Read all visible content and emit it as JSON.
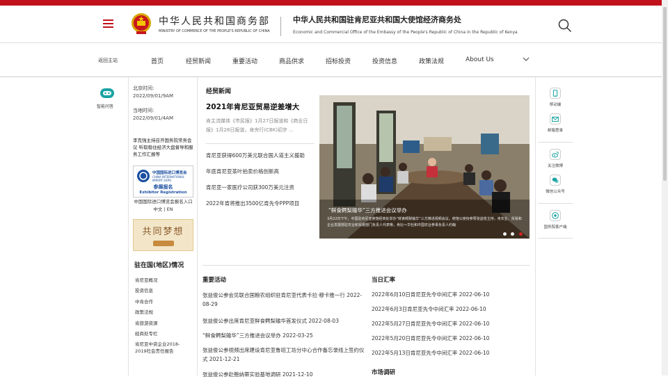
{
  "header": {
    "ministry_cn": "中华人民共和国商务部",
    "ministry_en": "MINISTRY OF COMMERCE OF THE PEOPLE'S REPUBLIC OF CHINA",
    "office_cn": "中华人民共和国驻肯尼亚共和国大使馆经济商务处",
    "office_en": "Economic and Commercial Office of the Embassy of the People's Republic of China in the Republic of Kenya"
  },
  "nav": {
    "back": "返回主站",
    "items": [
      "首页",
      "经贸新闻",
      "重要活动",
      "商品供求",
      "招标投资",
      "投资信息",
      "政策法规",
      "About Us"
    ]
  },
  "left": {
    "assistant": "智能问答",
    "beijing_label": "北京时间:",
    "beijing_time": "2022/09/01/9AM",
    "local_label": "当地时间:",
    "local_time": "2022/09/01/4AM",
    "news_link": "李克强主持召开国务院常务会议 听取稳住经济大盘督导和服务工作汇报等",
    "ciie_cn": "中国国际进口博览会",
    "ciie_en": "CHINA INTERNATIONAL IMPORT EXPO",
    "ciie_reg_cn": "参展报名",
    "ciie_reg_en": "Exhibitor Registration",
    "ciie_caption": "中国国际进口博览会报名入口 中文 | EN",
    "dream": "共同梦想",
    "country_title": "驻在国(地区)情况",
    "country_items": [
      "肯尼亚概况",
      "投资信息",
      "中肯合作",
      "政策法规",
      "肯旅游资源",
      "经商处专栏",
      "肯尼亚中资企业2018-2019社会责任报告"
    ]
  },
  "news": {
    "section": "经贸新闻",
    "headline": "2021年肯尼亚贸易逆差增大",
    "summary": "肯主流媒体《市民报》1月27日报道和《商业日报》1月28日报道，肯央行(CBK)初步 ...",
    "items": [
      "肯尼亚获得600万美元联合国人道主义援助",
      "年底肯尼亚茶叶拍卖价格创新高",
      "肯尼亚一家医疗公司获300万美元注资",
      "2022年肯将推出3500亿肯先令PPP项目"
    ]
  },
  "slider": {
    "caption": "“鲜食鳄梨输华”三方推进会议举办",
    "desc": "3月22日下午，中国驻肯尼亚使馆经商处举办“鲜食鳄梨输华”三方推进视频会议，使馆公使衔参赞张益俊主持，肯农业、贸易和企业发展部驻农业和贸易部门负责人代表等，肯比～华杜和中国农业参事负责人约翰"
  },
  "activities": {
    "title": "重要活动",
    "items": [
      {
        "text": "张益俊公参会见联合国粮农组织驻肯尼亚代表卡拉·穆卡推一行",
        "date": "2022-08-29"
      },
      {
        "text": "张益俊公参出席肯尼亚鲜食鳄梨输华首发仪式",
        "date": "2022-08-03"
      },
      {
        "text": "“鲜食鳄梨输华”三方推进会议举办",
        "date": "2022-03-25"
      },
      {
        "text": "张益俊公参视频出席建设肯尼亚鲁班工坊分中心合作备忘录线上签约仪式",
        "date": "2021-12-21"
      },
      {
        "text": "张益俊公参赴鲍纳蒂实验基地调研",
        "date": "2021-12-10"
      }
    ]
  },
  "rates": {
    "title": "当日汇率",
    "items": [
      {
        "text": "2022年6月10日肯尼亚先令中间汇率",
        "date": "2022-06-10"
      },
      {
        "text": "2022年6月3日肯尼亚先令中间汇率",
        "date": "2022-06-10"
      },
      {
        "text": "2022年5月27日肯尼亚先令中间汇率",
        "date": "2022-06-10"
      },
      {
        "text": "2022年5月20日肯尼亚先令中间汇率",
        "date": "2022-06-10"
      },
      {
        "text": "2022年5月13日肯尼亚先令中间汇率",
        "date": "2022-06-10"
      }
    ]
  },
  "market": {
    "title": "市场调研"
  },
  "right": {
    "items": [
      "移动端",
      "邮箱登录",
      "关注微博",
      "微信公众号",
      "国务院客户端"
    ]
  },
  "colors": {
    "brand_red": "#c1121b",
    "accent_teal": "#1aa3a3"
  }
}
